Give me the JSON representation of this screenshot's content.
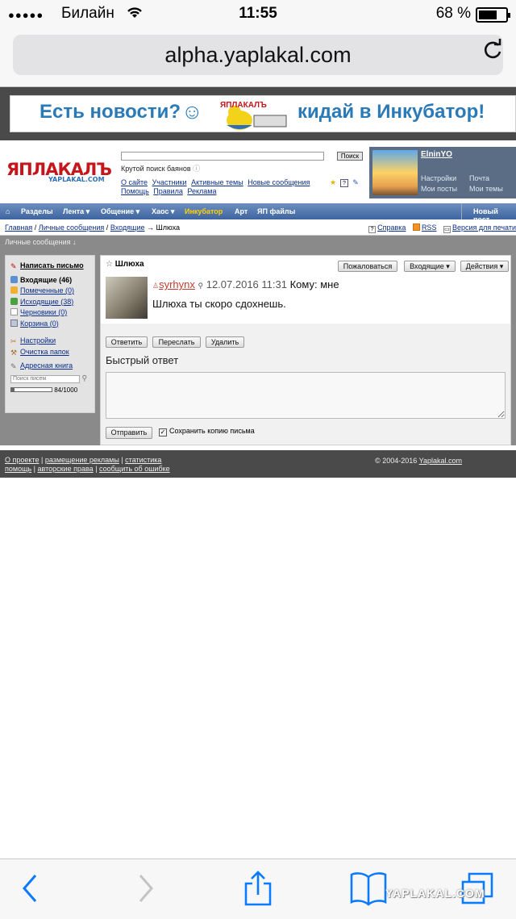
{
  "status_bar": {
    "carrier": "Билайн",
    "time": "11:55",
    "battery_percent": "68 %",
    "battery_level": 0.68
  },
  "browser": {
    "url": "alpha.yaplakal.com"
  },
  "banner": {
    "text_left": "Есть новости?",
    "smile": "☺",
    "text_right": "кидай в Инкубатор!",
    "logo_text": "ЯПЛАКАЛЪ"
  },
  "header": {
    "logo": "ЯПЛАКАЛЪ",
    "logo_sub": "YAPLAKAL.COM",
    "search_placeholder": "",
    "search_button": "Поиск",
    "tagline": "Крутой поиск баянов",
    "links": [
      "О сайте",
      "Участники",
      "Активные темы",
      "Новые сообщения",
      "Помощь",
      "Правила",
      "Реклама"
    ]
  },
  "user": {
    "name": "ElninYO",
    "links": [
      "Настройки",
      "Почта",
      "Мои посты",
      "Мои темы"
    ]
  },
  "nav": {
    "items": [
      "Разделы",
      "Лента ▾",
      "Общение ▾",
      "Хаос ▾",
      "Инкубатор",
      "Арт",
      "ЯП файлы"
    ],
    "new_posts": "Новый пост"
  },
  "breadcrumb": {
    "items": [
      "Главная",
      "Личные сообщения",
      "Входящие"
    ],
    "current": "Шлюха",
    "right": [
      "Справка",
      "RSS",
      "Версия для печати"
    ]
  },
  "section_title": "Личные сообщения ↓",
  "sidebar": {
    "compose": "Написать письмо",
    "folders": [
      "Входящие (46)",
      "Помеченные (0)",
      "Исходящие (38)",
      "Черновики (0)",
      "Корзина (0)"
    ],
    "tools": [
      "Настройки",
      "Очистка папок"
    ],
    "address_book": "Адресная книга",
    "search_placeholder": "Поиск писем",
    "quota_text": "84/1000",
    "quota_fraction": 0.084
  },
  "message": {
    "subject": "Шлюха",
    "buttons": [
      "Пожаловаться",
      "Входящие ▾",
      "Действия ▾"
    ],
    "sender": "syrhynx",
    "date": "12.07.2016 11:31",
    "to": "Кому: мне",
    "body": "Шлюха ты скоро сдохнешь.",
    "actions": [
      "Ответить",
      "Переслать",
      "Удалить"
    ]
  },
  "quick_reply": {
    "title": "Быстрый ответ",
    "send": "Отправить",
    "save_copy": "Сохранить копию письма",
    "save_checked": true
  },
  "footer": {
    "line1": [
      "О проекте",
      "размещение рекламы",
      "статистика"
    ],
    "line2": [
      "помощь",
      "авторские права",
      "сообщить об ошибке"
    ],
    "copyright_prefix": "© 2004-2016",
    "copyright_link": "Yaplakal.com"
  },
  "watermark": "YAPLAKAL.COM"
}
